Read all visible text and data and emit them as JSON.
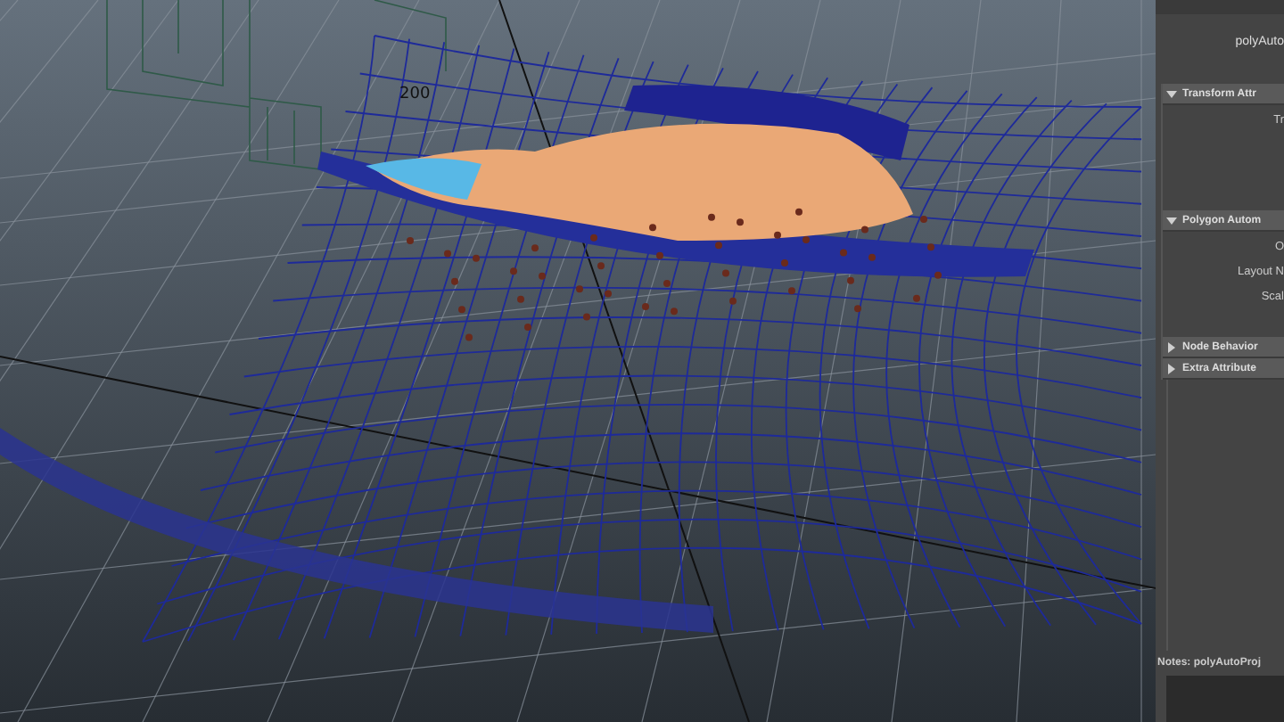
{
  "viewport": {
    "label": "200"
  },
  "attribute_editor": {
    "node_name": "polyAuto",
    "sections": [
      {
        "title": "Transform Attr",
        "expanded": true,
        "fields": [
          "Tr"
        ]
      },
      {
        "title": "Polygon Autom",
        "expanded": true,
        "fields": [
          "O",
          "Layout N",
          "Scal"
        ]
      },
      {
        "title": "Node Behavior",
        "expanded": false
      },
      {
        "title": "Extra Attribute",
        "expanded": false
      }
    ],
    "notes": "Notes: polyAutoProj"
  }
}
